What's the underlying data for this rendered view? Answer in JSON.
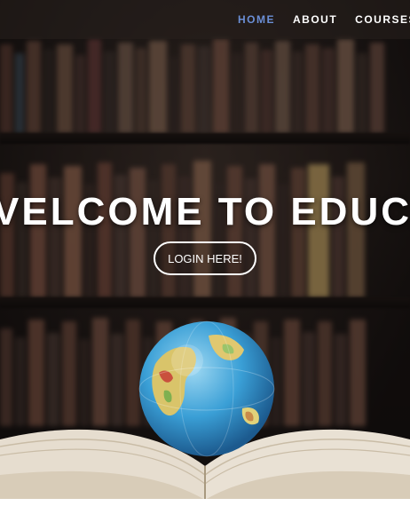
{
  "nav": {
    "items": [
      {
        "label": "HOME",
        "active": true
      },
      {
        "label": "ABOUT",
        "active": false
      },
      {
        "label": "COURSES",
        "active": false
      }
    ],
    "active_color": "#6b8fd6"
  },
  "hero": {
    "headline": "VELCOME TO EDUCA",
    "login_button": "LOGIN HERE!"
  },
  "icons": [
    "globe-illustration",
    "open-book-illustration"
  ]
}
